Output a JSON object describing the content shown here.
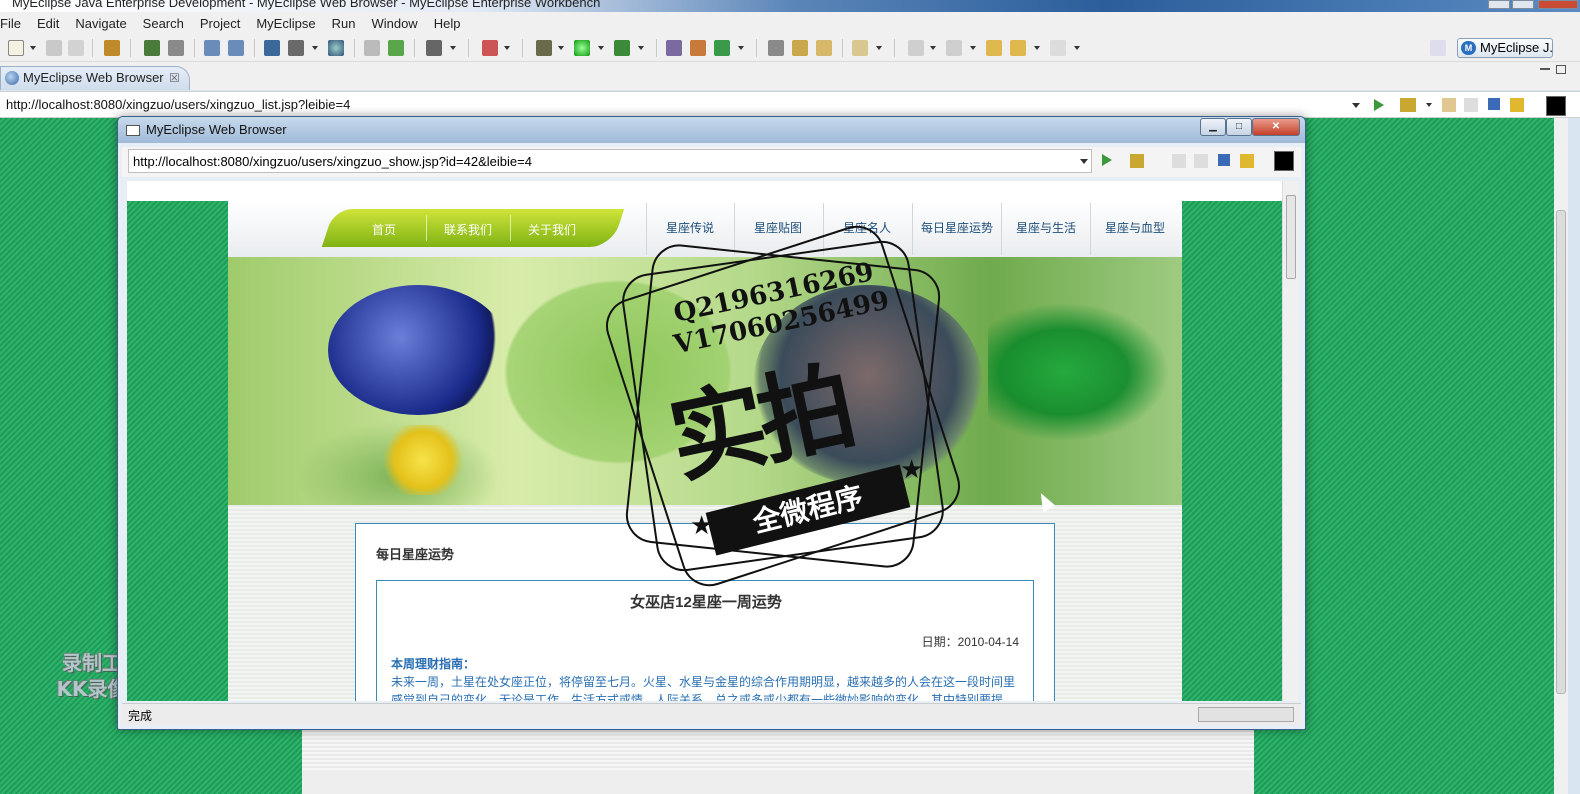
{
  "window": {
    "title": "MyEclipse Java Enterprise Development - MyEclipse Web Browser - MyEclipse Enterprise Workbench"
  },
  "menubar": {
    "items": [
      "File",
      "Edit",
      "Navigate",
      "Search",
      "Project",
      "MyEclipse",
      "Run",
      "Window",
      "Help"
    ]
  },
  "toolbar": {
    "perspective_label": "MyEclipse J..."
  },
  "editor_tab": {
    "label": "MyEclipse Web Browser",
    "close_glyph": "☒"
  },
  "main_browser": {
    "url": "http://localhost:8080/xingzuo/users/xingzuo_list.jsp?leibie=4"
  },
  "popup": {
    "title": "MyEclipse Web Browser",
    "url": "http://localhost:8080/xingzuo/users/xingzuo_show.jsp?id=42&leibie=4",
    "status": "完成",
    "controls": {
      "minimize": "▁",
      "maximize": "□",
      "close": "✕"
    }
  },
  "site": {
    "nav_left": [
      "首页",
      "联系我们",
      "关于我们"
    ],
    "nav_right": [
      "星座传说",
      "星座贴图",
      "星座名人",
      "每日星座运势",
      "星座与生活",
      "星座与血型"
    ],
    "section_title": "每日星座运势",
    "article": {
      "title": "女巫店12星座一周运势",
      "date": "日期：2010-04-14",
      "subtitle": "本周理财指南：",
      "body": "未来一周，土星在处女座正位，将停留至七月。火星、水星与金星的综合作用期明显，越来越多的人会在这一段时间里感觉到自己的变化，无论是工作、生活方式或情、人际关系，总之或多或少都有一些微妙影响的变化，其中特别要提"
    }
  },
  "stamp": {
    "line1": "Q2196316269",
    "line2": "V17060256499",
    "big": "实拍",
    "ribbon": "全微程序"
  },
  "watermark": {
    "line1": "录制工具",
    "line2": "KK录像机"
  },
  "colors": {
    "site_green": "#2db36a",
    "nav_green": "#8cc21f",
    "link_blue": "#2a6fb3",
    "box_border": "#3b8ab8"
  }
}
